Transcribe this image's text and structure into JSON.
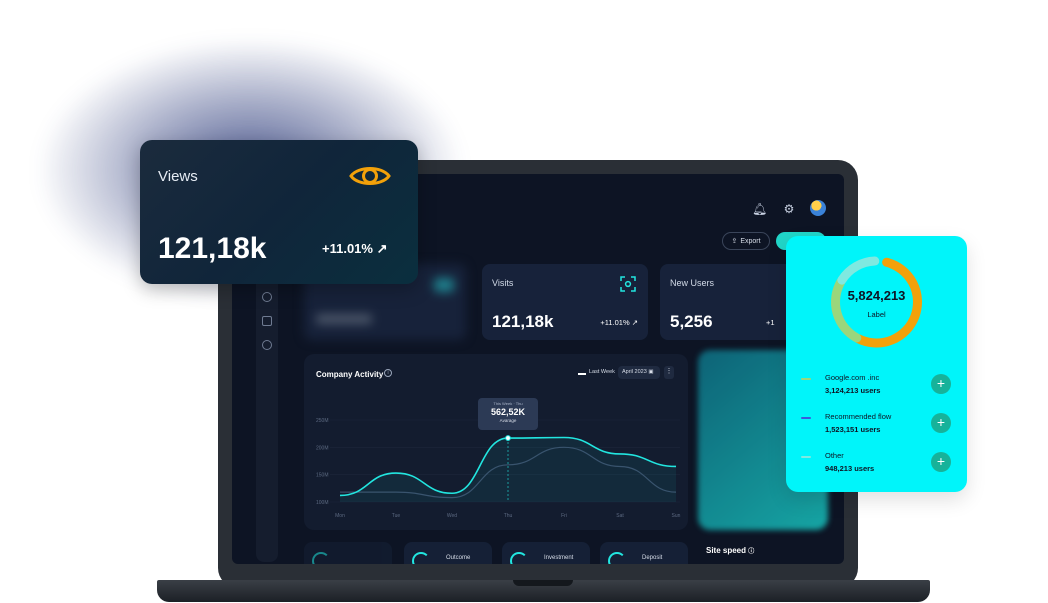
{
  "views_card": {
    "title": "Views",
    "value": "121,18k",
    "change": "+11.01%",
    "icon": "eye-icon",
    "accent": "#f2a10a"
  },
  "dashboard": {
    "header": {
      "export_label": "Export"
    },
    "stats": [
      {
        "label": "Visits",
        "value": "121,18k",
        "change": "+11.01%"
      },
      {
        "label": "New Users",
        "value": "5,256",
        "change": "+1"
      }
    ],
    "activity": {
      "title": "Company Activity",
      "legend": "Last Week",
      "date": "April 2023",
      "tooltip": {
        "caption": "This Week · Thu",
        "value": "562,52K",
        "sub": "Avarage"
      }
    },
    "bottom_cards": [
      "Outcome",
      "Investment",
      "Deposit"
    ],
    "site_speed": "Site speed"
  },
  "chart_data": {
    "type": "line",
    "categories": [
      "Mon",
      "Tue",
      "Wed",
      "Thu",
      "Fri",
      "Sat",
      "Sun"
    ],
    "yticks": [
      "100M",
      "150M",
      "200M",
      "250M"
    ],
    "ylim": [
      100,
      250
    ],
    "series": [
      {
        "name": "Last Week",
        "color": "#3c4a66",
        "values": [
          118,
          118,
          108,
          168,
          200,
          165,
          118
        ]
      },
      {
        "values": [
          112,
          153,
          116,
          217,
          218,
          188,
          165
        ],
        "color": "#22e6e0"
      }
    ]
  },
  "donut": {
    "total": "5,824,213",
    "label": "Label",
    "items": [
      {
        "name": "Google.com .inc",
        "users": "3,124,213 users",
        "color": "#f2a10a",
        "share": 0.54
      },
      {
        "name": "Recommended flow",
        "users": "1,523,151 users",
        "color": "#9ad67c",
        "share": 0.26
      },
      {
        "name": "Other",
        "users": "948,213 users",
        "color": "#7fe9e0",
        "share": 0.16
      }
    ],
    "colors": {
      "card": "#00f5fa",
      "plus": "#17b29a",
      "dash2": "#3b5bdb"
    }
  }
}
